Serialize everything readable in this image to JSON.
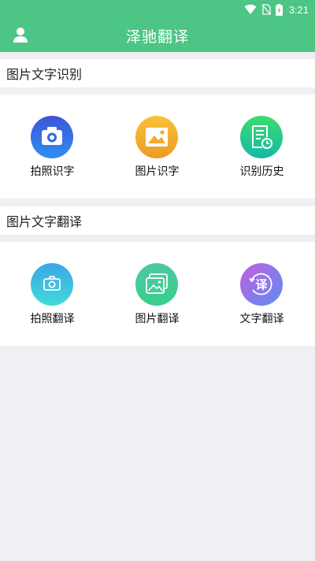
{
  "status_bar": {
    "time": "3:21"
  },
  "app_bar": {
    "title": "泽驰翻译"
  },
  "recognition": {
    "header": "图片文字识别",
    "items": [
      {
        "label": "拍照识字",
        "icon": "camera-icon"
      },
      {
        "label": "图片识字",
        "icon": "image-icon"
      },
      {
        "label": "识别历史",
        "icon": "history-icon"
      }
    ]
  },
  "translation": {
    "header": "图片文字翻译",
    "items": [
      {
        "label": "拍照翻译",
        "icon": "camera-icon"
      },
      {
        "label": "图片翻译",
        "icon": "images-icon"
      },
      {
        "label": "文字翻译",
        "icon": "translate-icon"
      }
    ]
  },
  "colors": {
    "primary": "#4cc585",
    "camera_blue": "#2f6fe0",
    "image_orange": "#f0a72a",
    "history_green": "#22c28a",
    "camera_cyan": "#38c4e4",
    "images_teal": "#3fcf9a",
    "translate_purple": "#8a6fe6"
  }
}
